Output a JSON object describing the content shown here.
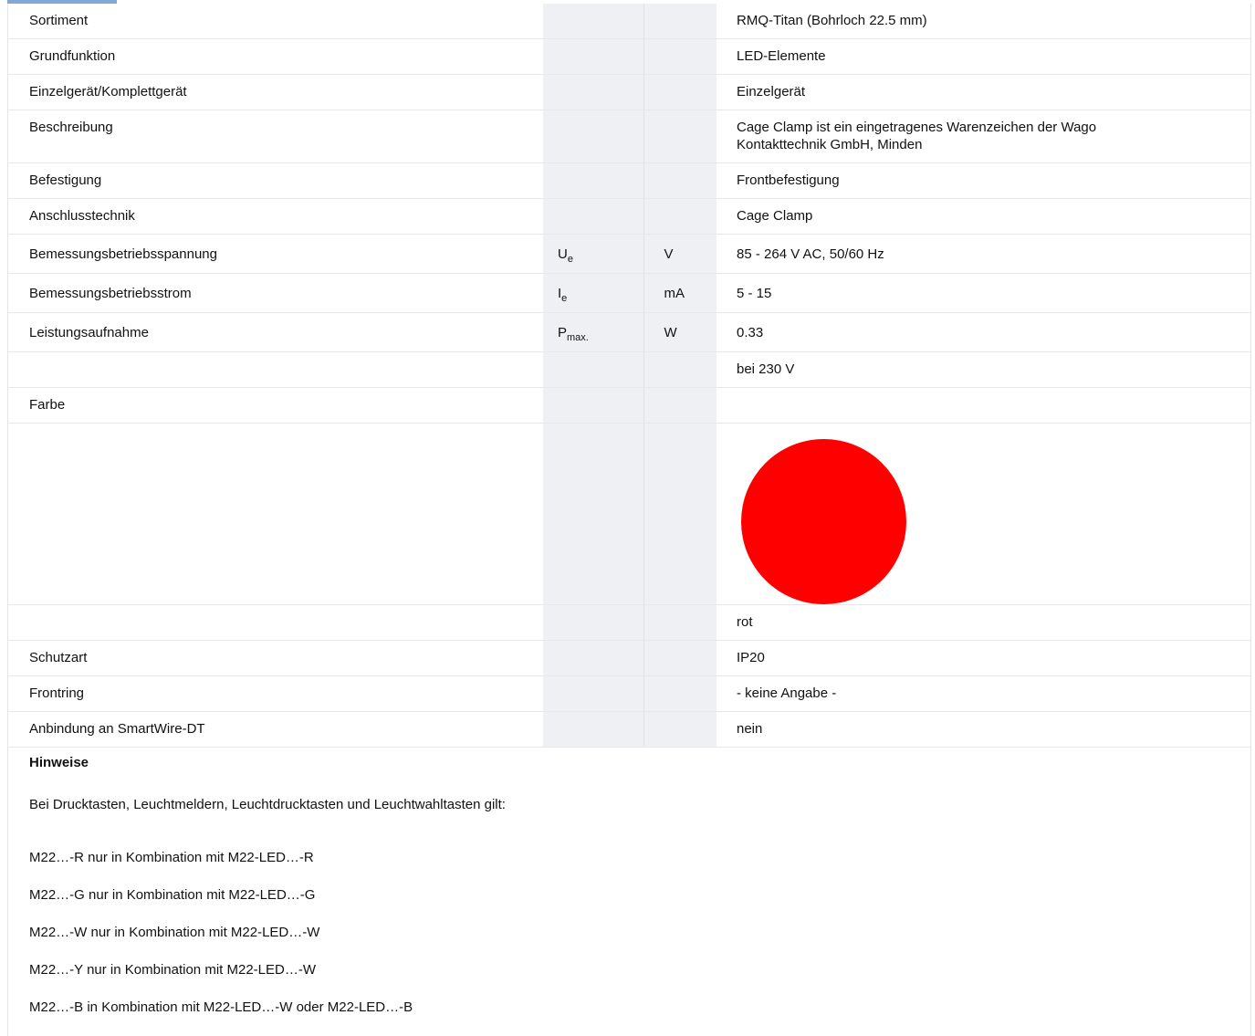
{
  "rows": [
    {
      "name": "Sortiment",
      "value": "RMQ-Titan (Bohrloch 22.5 mm)"
    },
    {
      "name": "Grundfunktion",
      "value": "LED-Elemente"
    },
    {
      "name": "Einzelgerät/Komplettgerät",
      "value": "Einzelgerät"
    },
    {
      "name": "Beschreibung",
      "value": "Cage Clamp ist ein eingetragenes Warenzeichen der Wago Kontakttechnik GmbH, Minden"
    },
    {
      "name": "Befestigung",
      "value": "Frontbefestigung"
    },
    {
      "name": "Anschlusstechnik",
      "value": "Cage Clamp"
    },
    {
      "name": "Bemessungsbetriebsspannung",
      "sym_main": "U",
      "sym_sub": "e",
      "unit": "V",
      "value": "85 - 264 V AC, 50/60 Hz"
    },
    {
      "name": "Bemessungsbetriebsstrom",
      "sym_main": "I",
      "sym_sub": "e",
      "unit": "mA",
      "value": "5 - 15"
    },
    {
      "name": "Leistungsaufnahme",
      "sym_main": "P",
      "sym_sub": "max.",
      "unit": "W",
      "value": "0.33"
    },
    {
      "name": "",
      "value": "bei 230 V"
    },
    {
      "name": "Farbe",
      "value": ""
    },
    {
      "name": "",
      "value": "rot"
    },
    {
      "name": "Schutzart",
      "value": "IP20"
    },
    {
      "name": "Frontring",
      "value": "- keine Angabe -"
    },
    {
      "name": "Anbindung an SmartWire-DT",
      "value": "nein"
    }
  ],
  "color_swatch": {
    "color": "#ff0000"
  },
  "notes": {
    "heading": "Hinweise",
    "intro": "Bei Drucktasten, Leuchtmeldern, Leuchtdrucktasten und Leuchtwahltasten gilt:",
    "lines": [
      "M22…-R nur in Kombination mit M22-LED…-R",
      "M22…-G nur in Kombination mit M22-LED…-G",
      "M22…-W nur in Kombination mit M22-LED…-W",
      "M22…-Y nur in Kombination mit M22-LED…-W",
      "M22…-B in Kombination mit M22-LED…-W oder M22-LED…-B"
    ]
  }
}
